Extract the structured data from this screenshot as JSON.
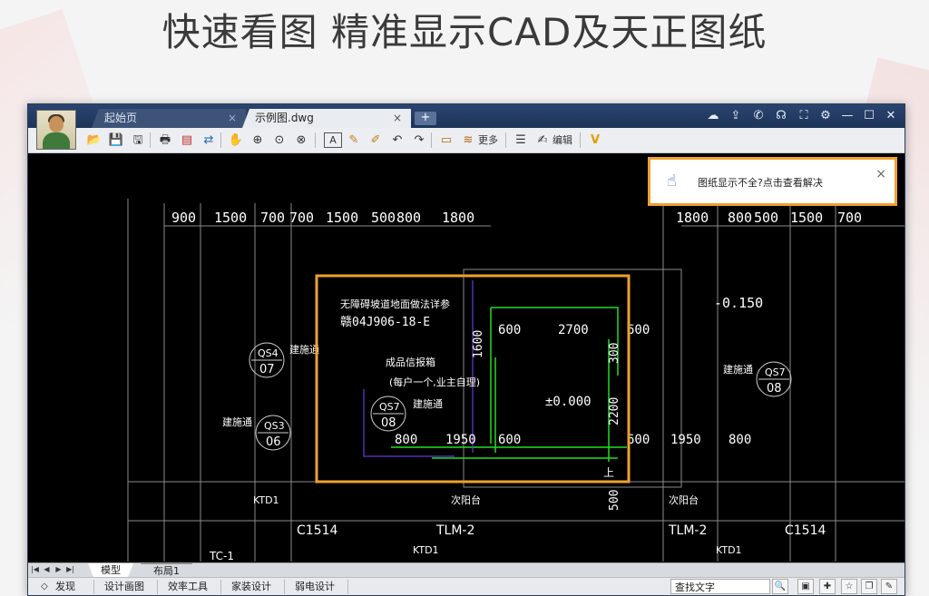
{
  "headline": "快速看图  精准显示CAD及天正图纸",
  "tabs": [
    {
      "label": "起始页",
      "close": "×"
    },
    {
      "label": "示例图.dwg",
      "close": "×"
    }
  ],
  "new_tab": "+",
  "window_controls": {
    "cloud": "☁",
    "share": "⇪",
    "wechat": "✆",
    "support": "☊",
    "fullscreen": "⛶",
    "settings": "⚙",
    "minimize": "—",
    "maximize": "☐",
    "close": "✕"
  },
  "toolbar": {
    "more_label": "更多",
    "edit_label": "编辑",
    "text_tool": "A"
  },
  "notice": {
    "message": "图纸显示不全?点击查看解决",
    "close": "×"
  },
  "drawing": {
    "dims_top_left": [
      "900",
      "1500",
      "700",
      "700",
      "1500",
      "500",
      "800",
      "1800"
    ],
    "dims_top_right": [
      "1800",
      "800",
      "500",
      "1500",
      "700"
    ],
    "elevation_right": "-0.150",
    "elevation_center": "±0.000",
    "note1": "无障碍坡道地面做法详参",
    "note2": "赣04J906-18-E",
    "note3": "成品信报箱",
    "note4": "(每户一个,业主自理)",
    "tags": [
      {
        "code": "QS4",
        "num": "07",
        "label": "建施通"
      },
      {
        "code": "QS3",
        "num": "06",
        "label": "建施通"
      },
      {
        "code": "QS7",
        "num": "08",
        "label": "建施通"
      },
      {
        "code": "QS7",
        "num": "08",
        "label": "建施通"
      }
    ],
    "dims_center": [
      "600",
      "2700",
      "600",
      "1600",
      "300",
      "2200",
      "800",
      "1950",
      "600",
      "600",
      "1950",
      "800",
      "500"
    ],
    "ktd1": "KTD1",
    "balcony": "次阳台",
    "tlm2": "TLM-2",
    "c1514": "C1514",
    "tc": "TC-1",
    "down": "上"
  },
  "layout_tabs": {
    "model": "模型",
    "layout1": "布局1"
  },
  "statusbar": {
    "items": [
      "发现",
      "设计画图",
      "效率工具",
      "家装设计",
      "弱电设计"
    ],
    "search_placeholder": "查找文字"
  },
  "colors": {
    "highlight_orange": "#f0a030",
    "cad_green": "#22dd22",
    "cad_white": "#ffffff",
    "titlebar": "#1e3559"
  }
}
